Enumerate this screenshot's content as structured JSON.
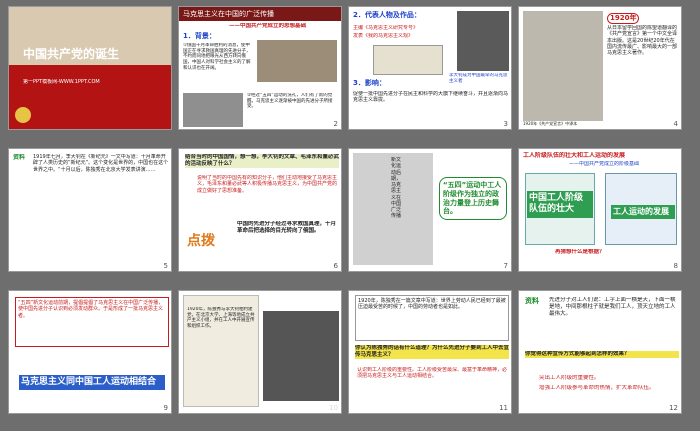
{
  "slides": {
    "s1": {
      "title": "中国共产党的诞生",
      "sub": "第一PPT模板网-WWW.1PPT.COM"
    },
    "s2": {
      "header": "马克思主义在中国的广泛传播",
      "band": "——中国共产党成立的思想基础",
      "sec1": "1．背景：",
      "p1": "①俄国十月革命胜利的消息，使中国正在寻求救国真理的先进分子，不约而同地把眼光从西方转向俄国，中国人对科学社会主义的了解和认识也在开阔。",
      "p2": "②经过“五四”运动的洗礼，人们有了新的觉醒。马克思主义逐渐被中国的先进分子所接受。"
    },
    "s3": {
      "sec2": "2．代表人物及作品：",
      "p1": "主编《马克思主义研究专号》",
      "p2": "发表《我的马克思主义观》",
      "cap": "李大钊成为中国最早的马克思主义者",
      "sec3": "3．影响：",
      "p3": "促使一批中国先进分子在民主和科学的大旗下继续奋斗，并且逐渐向马克思主义靠拢。"
    },
    "s4": {
      "year": "1920年",
      "p": "从日本留学回国的陈望道翻译的《共产党宣言》第一个中文全译本出版。这是20世纪20年代在国内流传最广、影响最大的一部马克思主义著作。",
      "cap": "1920年《共产党宣言》中译本"
    },
    "s5": {
      "src": "资料",
      "p": "1919年七月，李大钊在《新纪元》一文中写道：十月革命开辟了人类历史的“新纪元”。这个变化是世界的，中国也在这个世界之中。“十月以后，陈独秀在北京大学发表讲演……"
    },
    "s6": {
      "q": "结合当时的中国国情，想一想，李大钊的文章、毛泽东和董必武的活动反映了什么？",
      "a": "说明了当时的中国先有的知识分子，他们主动地接受了马克思主义，毛泽东和董必武等人积极传播马克思主义，为中国共产党的成立做好了思想准备。",
      "tag": "点拨",
      "note": "中国的先进分子经过寻求救国真理，十月革命后把选择的目光转向了俄国。"
    },
    "s7": {
      "side": "新文化运动后期，马克思主义在中国广泛传播",
      "bubble": "“五四”运动中工人阶级作为独立的政治力量登上历史舞台。"
    },
    "s8": {
      "header": "工人阶级队伍的壮大和工人运动的发展",
      "band": "——中国共产党成立的阶级基础",
      "left": "中国工人阶级队伍的壮大",
      "right": "工人运动的发展",
      "q": "再猜想什么是根据？"
    },
    "s9": {
      "p": "“五四”新文化运动前期，提倡提倡了马克思主义在中国广泛传播，使中国先进分子认识到必须发动群众。于是形成了一批马克思主义者。",
      "box": "马克思主义同中国工人运动相结合"
    },
    "s10": {
      "p": "1920年，陈独秀与李大钊相约建党，在北京大学、上海等地成立共产主义小组，并在工人中开展宣传和组织工作。"
    },
    "s11": {
      "p": "1920年，陈独秀在一篇文章中写道：世界上劳动人民已经到了最被压迫最受苦的时候了，中国的劳动者也是如此。",
      "q": "你认为陈独秀的话有什么道理？为什么先进分子要到工人中去宣传马克思主义？",
      "a": "认识到工人阶级的重要性。工人阶级受苦最深、最富于革命精神，必须把马克思主义与工人运动相结合。"
    },
    "s12": {
      "src": "资料",
      "quote": "先进分子对工人们说：工字上面一横是天，下面一横是地，中间那根柱子就是我们工人，顶天立地的工人最伟大。",
      "q": "你觉得这种宣传方式能够起到怎样的效果？",
      "a1": "突出工人阶级的重要性。",
      "a2": "增强工人阶级参与革命的热情，扩大革命队伍。"
    }
  },
  "numbers": [
    "1",
    "2",
    "3",
    "4",
    "5",
    "6",
    "7",
    "8",
    "9",
    "10",
    "11",
    "12"
  ],
  "colors": {
    "red": "#c81d1d",
    "grey": "#6e6e6e",
    "blue": "#2b5ec9",
    "green": "#1f8c2e",
    "yellow": "#f2e44a"
  }
}
